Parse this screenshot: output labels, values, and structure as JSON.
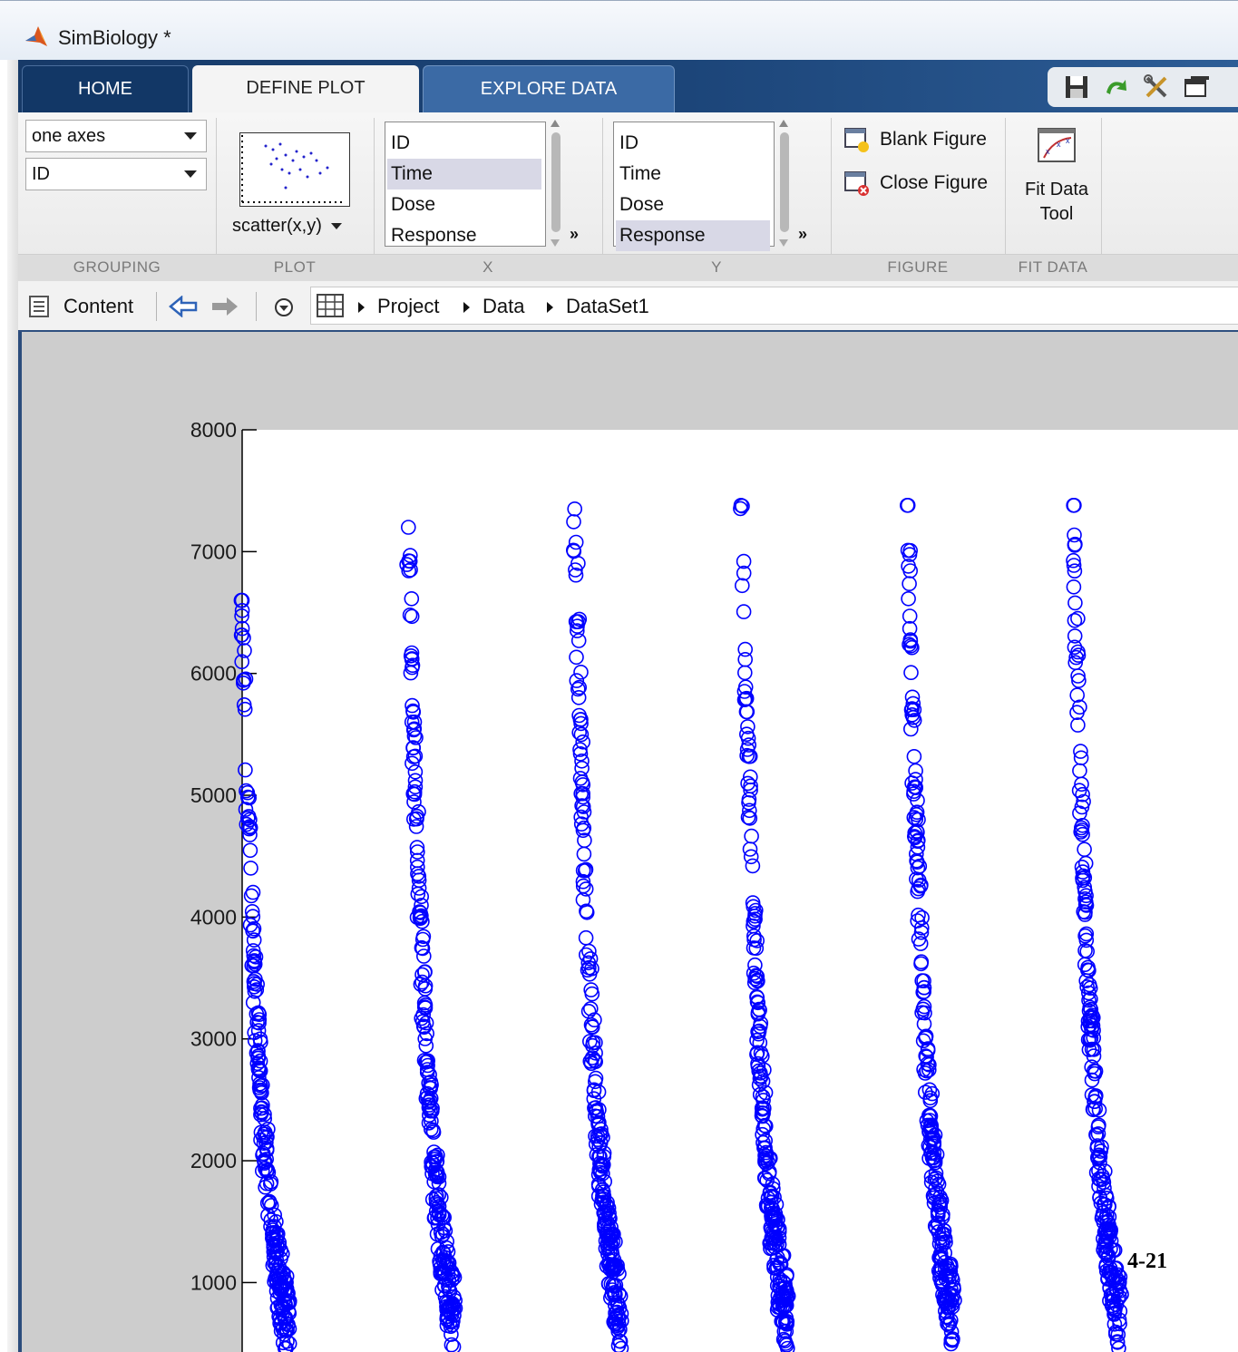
{
  "window": {
    "title": "SimBiology *"
  },
  "tabs": [
    {
      "label": "HOME"
    },
    {
      "label": "DEFINE PLOT"
    },
    {
      "label": "EXPLORE DATA"
    }
  ],
  "quick_access": [
    "save-icon",
    "undo-icon",
    "tools-icon",
    "window-icon"
  ],
  "ribbon": {
    "grouping": {
      "label": "GROUPING",
      "layout_value": "one axes",
      "group_value": "ID"
    },
    "plot": {
      "label": "PLOT",
      "type_label": "scatter(x,y)"
    },
    "x": {
      "label": "X",
      "items": [
        "ID",
        "Time",
        "Dose",
        "Response"
      ],
      "selected": "Time",
      "more": "»"
    },
    "y": {
      "label": "Y",
      "items": [
        "ID",
        "Time",
        "Dose",
        "Response"
      ],
      "selected": "Response",
      "more": "»"
    },
    "figure": {
      "label": "FIGURE",
      "blank_label": "Blank Figure",
      "close_label": "Close Figure"
    },
    "fit": {
      "label": "FIT DATA",
      "line1": "Fit Data",
      "line2": "Tool"
    }
  },
  "addressbar": {
    "content_label": "Content",
    "path": [
      "Project",
      "Data",
      "DataSet1"
    ]
  },
  "colors": {
    "marker": "#0000ff",
    "tab_bg": "#1c4579",
    "selection": "#d8d8e6"
  },
  "chart_data": {
    "type": "scatter",
    "marker": "open-circle",
    "y_ticks": [
      1000,
      2000,
      3000,
      4000,
      5000,
      6000,
      7000,
      8000
    ],
    "ylim": [
      430,
      8000
    ],
    "xlim": [
      0,
      150
    ],
    "clusters": [
      {
        "x_start": 0,
        "peak": 6600
      },
      {
        "x_start": 25,
        "peak": 7200
      },
      {
        "x_start": 50,
        "peak": 7350
      },
      {
        "x_start": 75,
        "peak": 7380
      },
      {
        "x_start": 100,
        "peak": 7380
      },
      {
        "x_start": 125,
        "peak": 7380
      }
    ]
  },
  "page_number": "4-21"
}
